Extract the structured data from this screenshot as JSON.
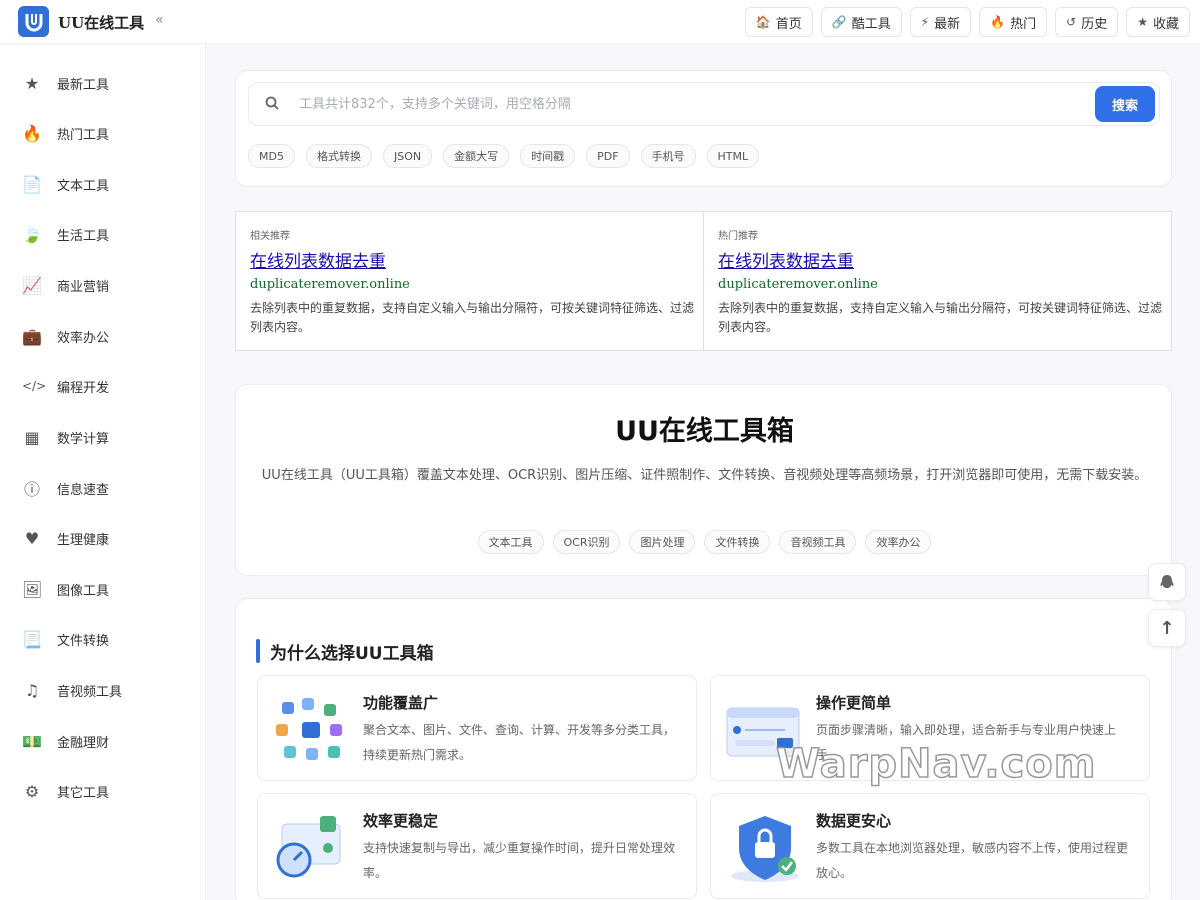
{
  "header": {
    "title": "UU在线工具",
    "collapse": "«",
    "nav": [
      {
        "icon": "🏠",
        "icon_name": "home-icon",
        "label": "首页"
      },
      {
        "icon": "🔗",
        "icon_name": "link-icon",
        "label": "酷工具"
      },
      {
        "icon": "⚡",
        "icon_name": "bolt-icon",
        "label": "最新"
      },
      {
        "icon": "🔥",
        "icon_name": "fire-icon",
        "label": "热门"
      },
      {
        "icon": "↺",
        "icon_name": "history-icon",
        "label": "历史"
      },
      {
        "icon": "★",
        "icon_name": "star-icon",
        "label": "收藏"
      }
    ]
  },
  "sidebar": {
    "items": [
      {
        "icon": "★",
        "icon_name": "star-icon",
        "label": "最新工具"
      },
      {
        "icon": "🔥",
        "icon_name": "fire-icon",
        "label": "热门工具"
      },
      {
        "icon": "📄",
        "icon_name": "document-icon",
        "label": "文本工具"
      },
      {
        "icon": "🍃",
        "icon_name": "leaf-icon",
        "label": "生活工具"
      },
      {
        "icon": "📈",
        "icon_name": "chart-line-icon",
        "label": "商业营销"
      },
      {
        "icon": "💼",
        "icon_name": "briefcase-icon",
        "label": "效率办公"
      },
      {
        "icon": "</>",
        "icon_name": "code-icon",
        "label": "编程开发"
      },
      {
        "icon": "▦",
        "icon_name": "calculator-icon",
        "label": "数学计算"
      },
      {
        "icon": "ⓘ",
        "icon_name": "info-icon",
        "label": "信息速查"
      },
      {
        "icon": "♥",
        "icon_name": "heartbeat-icon",
        "label": "生理健康"
      },
      {
        "icon": "🖼",
        "icon_name": "image-icon",
        "label": "图像工具"
      },
      {
        "icon": "📃",
        "icon_name": "file-convert-icon",
        "label": "文件转换"
      },
      {
        "icon": "♫",
        "icon_name": "music-icon",
        "label": "音视频工具"
      },
      {
        "icon": "💵",
        "icon_name": "money-icon",
        "label": "金融理财"
      },
      {
        "icon": "⚙",
        "icon_name": "gear-icon",
        "label": "其它工具"
      }
    ]
  },
  "search": {
    "placeholder": "工具共计832个，支持多个关键词，用空格分隔",
    "button": "搜索",
    "tags": [
      "MD5",
      "格式转换",
      "JSON",
      "金额大写",
      "时间戳",
      "PDF",
      "手机号",
      "HTML"
    ]
  },
  "ads": [
    {
      "label": "相关推荐",
      "title": "在线列表数据去重",
      "domain": "duplicateremover.online",
      "desc": "去除列表中的重复数据，支持自定义输入与输出分隔符，可按关键词特征筛选、过滤列表内容。"
    },
    {
      "label": "热门推荐",
      "title": "在线列表数据去重",
      "domain": "duplicateremover.online",
      "desc": "去除列表中的重复数据，支持自定义输入与输出分隔符，可按关键词特征筛选、过滤列表内容。"
    }
  ],
  "intro": {
    "title": "UU在线工具箱",
    "desc": "UU在线工具（UU工具箱）覆盖文本处理、OCR识别、图片压缩、证件照制作、文件转换、音视频处理等高频场景，打开浏览器即可使用，无需下载安装。",
    "tags": [
      "文本工具",
      "OCR识别",
      "图片处理",
      "文件转换",
      "音视频工具",
      "效率办公"
    ]
  },
  "why": {
    "title": "为什么选择UU工具箱",
    "features": [
      {
        "title": "功能覆盖广",
        "desc": "聚合文本、图片、文件、查询、计算、开发等多分类工具，持续更新热门需求。"
      },
      {
        "title": "操作更简单",
        "desc": "页面步骤清晰，输入即处理，适合新手与专业用户快速上手。"
      },
      {
        "title": "效率更稳定",
        "desc": "支持快速复制与导出，减少重复操作时间，提升日常处理效率。"
      },
      {
        "title": "数据更安心",
        "desc": "多数工具在本地浏览器处理，敏感内容不上传，使用过程更放心。"
      }
    ]
  },
  "floating": {
    "top": "↑"
  },
  "watermark": "WarpNav.com",
  "colors": {
    "primary": "#2f6fe8",
    "accent_bar": "#2f6fd6",
    "ad_link": "#1a0dab",
    "ad_domain": "#0b6b2a"
  }
}
